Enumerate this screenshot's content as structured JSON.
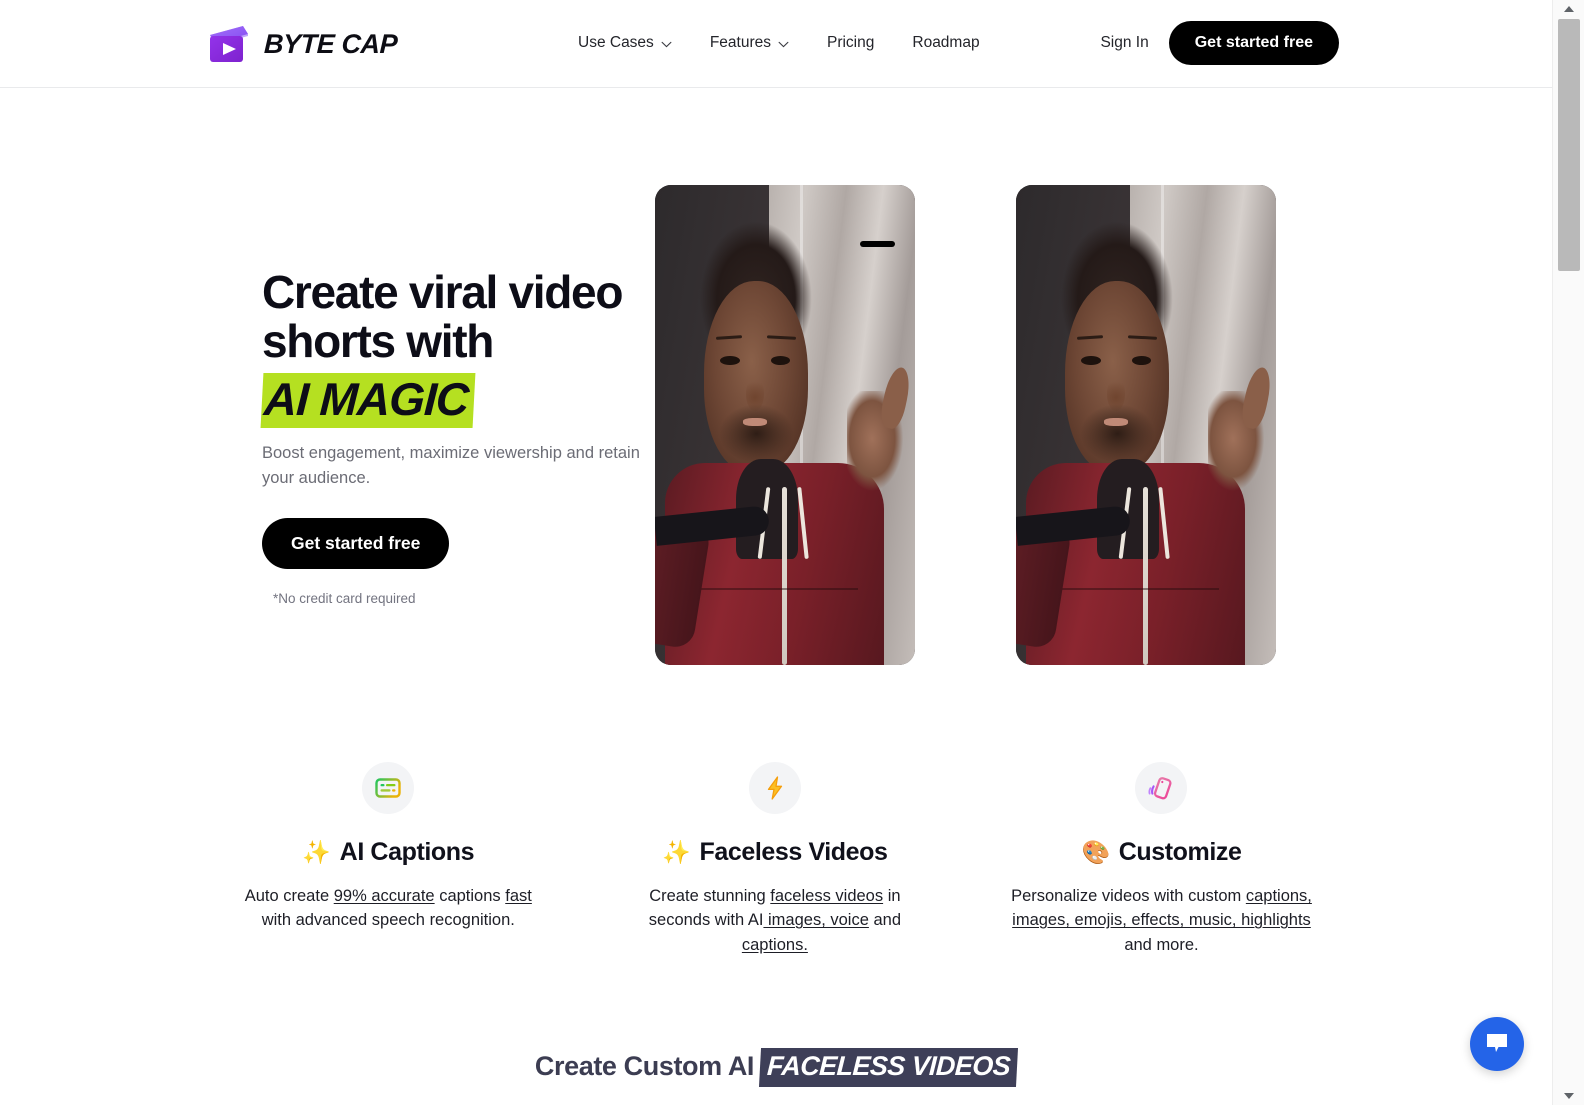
{
  "brand": {
    "name": "BYTE CAP",
    "logo_icon": "clapperboard-play-icon",
    "colors": {
      "primary_start": "#a855f7",
      "primary_end": "#7c3aed"
    }
  },
  "nav": {
    "items": [
      {
        "label": "Use Cases",
        "has_dropdown": true
      },
      {
        "label": "Features",
        "has_dropdown": true
      },
      {
        "label": "Pricing",
        "has_dropdown": false
      },
      {
        "label": "Roadmap",
        "has_dropdown": false
      }
    ],
    "sign_in": "Sign In",
    "cta": "Get started free"
  },
  "hero": {
    "headline_line1": "Create viral video",
    "headline_line2": "shorts with",
    "headline_highlight": "AI MAGIC",
    "highlight_color": "#b5e021",
    "subtext": "Boost engagement, maximize viewership and retain your audience.",
    "cta": "Get started free",
    "note": "*No credit card required"
  },
  "features": [
    {
      "icon": "captions-box-icon",
      "emoji": "✨",
      "title": "AI Captions",
      "desc_parts": [
        {
          "text": "Auto create ",
          "underline": false
        },
        {
          "text": "99% accurate",
          "underline": true
        },
        {
          "text": " captions ",
          "underline": false
        },
        {
          "text": "fast",
          "underline": true
        },
        {
          "text": " with advanced speech recognition.",
          "underline": false
        }
      ]
    },
    {
      "icon": "lightning-bolt-icon",
      "emoji": "✨",
      "title": "Faceless Videos",
      "desc_parts": [
        {
          "text": "Create stunning ",
          "underline": false
        },
        {
          "text": "faceless videos",
          "underline": true
        },
        {
          "text": " in seconds with AI",
          "underline": false
        },
        {
          "text": " images, voice",
          "underline": true
        },
        {
          "text": " and ",
          "underline": false
        },
        {
          "text": "captions.",
          "underline": true
        }
      ]
    },
    {
      "icon": "tilted-phone-icon",
      "emoji": "🎨",
      "title": "Customize",
      "desc_parts": [
        {
          "text": "Personalize videos with custom ",
          "underline": false
        },
        {
          "text": "captions,",
          "underline": true
        },
        {
          "text": " ",
          "underline": false
        },
        {
          "text": "images, emojis, effects, music, highlights",
          "underline": true
        },
        {
          "text": " and more.",
          "underline": false
        }
      ]
    }
  ],
  "bottom_section": {
    "heading_prefix": "Create Custom AI",
    "heading_badge": "FACELESS VIDEOS",
    "badge_bg": "#3e3f58"
  },
  "videos": [
    {
      "label": "video-preview-1",
      "has_dash_overlay": true
    },
    {
      "label": "video-preview-2",
      "has_dash_overlay": false
    }
  ],
  "chat": {
    "icon": "chat-bubble-icon",
    "color": "#2464e8"
  },
  "scrollbar": {
    "position_percent": 2
  }
}
